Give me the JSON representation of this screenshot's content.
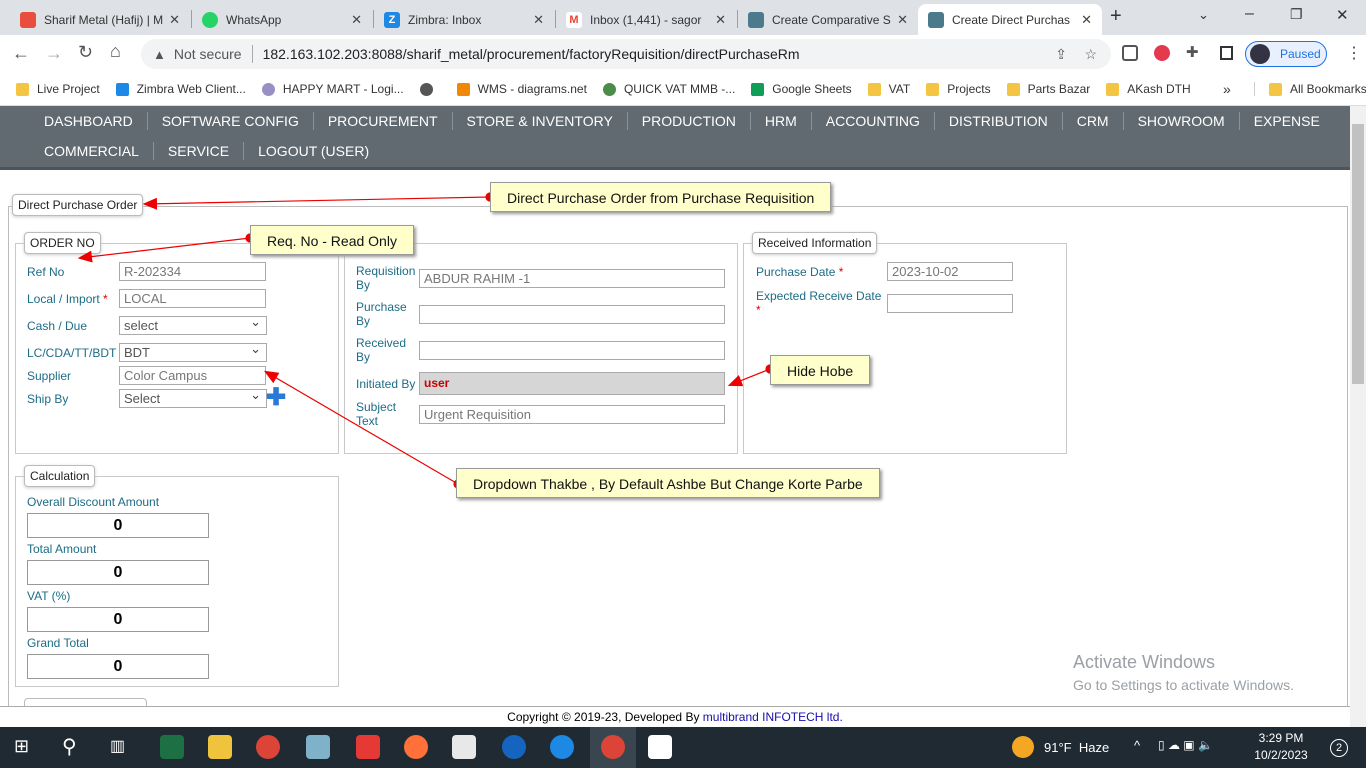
{
  "browser": {
    "tabs": [
      {
        "title": "Sharif Metal (Hafij) | M",
        "icon": "app-icon",
        "color": "#e84d3d"
      },
      {
        "title": "WhatsApp",
        "icon": "whatsapp-icon",
        "color": "#25d366"
      },
      {
        "title": "Zimbra: Inbox",
        "icon": "zimbra-icon",
        "color": "#1e88e5"
      },
      {
        "title": "Inbox (1,441) - sagor",
        "icon": "gmail-icon",
        "color": "#ea4335"
      },
      {
        "title": "Create Comparative S",
        "icon": "app-icon",
        "color": "#4a7a8c"
      },
      {
        "title": "Create Direct Purchas",
        "icon": "app-icon",
        "color": "#4a7a8c"
      }
    ],
    "security": "Not secure",
    "url": "182.163.102.203:8088/sharif_metal/procurement/factoryRequisition/directPurchaseRm",
    "profile": "Paused",
    "bookmarks": [
      {
        "label": "Live Project",
        "color": "#f4c542"
      },
      {
        "label": "Zimbra Web Client...",
        "color": "#1e88e5"
      },
      {
        "label": "HAPPY MART - Logi...",
        "color": "#9a8fc5"
      },
      {
        "label": "",
        "color": "#555"
      },
      {
        "label": "WMS - diagrams.net",
        "color": "#f08705"
      },
      {
        "label": "QUICK VAT MMB -...",
        "color": "#4c8c4a"
      },
      {
        "label": "Google Sheets",
        "color": "#0f9d58"
      },
      {
        "label": "VAT",
        "color": "#f4c542"
      },
      {
        "label": "Projects",
        "color": "#f4c542"
      },
      {
        "label": "Parts Bazar",
        "color": "#f4c542"
      },
      {
        "label": "AKash DTH",
        "color": "#f4c542"
      }
    ],
    "more": "»",
    "all_bookmarks": "All Bookmarks"
  },
  "nav": {
    "row1": [
      "DASHBOARD",
      "SOFTWARE CONFIG",
      "PROCUREMENT",
      "STORE & INVENTORY",
      "PRODUCTION",
      "HRM",
      "ACCOUNTING",
      "DISTRIBUTION",
      "CRM",
      "SHOWROOM",
      "EXPENSE"
    ],
    "row2": [
      "COMMERCIAL",
      "SERVICE",
      "LOGOUT (USER)"
    ]
  },
  "form": {
    "title": "Direct Purchase Order",
    "order": {
      "legend": "ORDER NO",
      "ref_label": "Ref No",
      "ref_value": "R-202334",
      "local_label": "Local / Import",
      "local_value": "LOCAL",
      "cash_label": "Cash / Due",
      "cash_value": "select",
      "lc_label": "LC/CDA/TT/BDT",
      "lc_value": "BDT",
      "supplier_label": "Supplier",
      "supplier_value": "Color Campus",
      "ship_label": "Ship By",
      "ship_value": "Select",
      "required": "*"
    },
    "req": {
      "req_by_label": "Requisition By",
      "req_by_value": "ABDUR RAHIM -1",
      "purchase_by_label": "Purchase By",
      "purchase_by_value": "",
      "received_by_label": "Received By",
      "received_by_value": "",
      "initiated_label": "Initiated By",
      "initiated_value": "user",
      "subject_label": "Subject Text",
      "subject_value": "Urgent Requisition"
    },
    "received": {
      "legend": "Received Information",
      "purchase_date_label": "Purchase Date",
      "purchase_date_value": "2023-10-02",
      "expected_label": "Expected Receive Date",
      "expected_value": ""
    },
    "calc": {
      "legend": "Calculation",
      "discount_label": "Overall Discount Amount",
      "discount_value": "0",
      "total_label": "Total Amount",
      "total_value": "0",
      "vat_label": "VAT (%)",
      "vat_value": "0",
      "grand_label": "Grand Total",
      "grand_value": "0"
    }
  },
  "notes": {
    "n1": "Direct Purchase Order from Purchase Requisition",
    "n2": "Req. No - Read Only",
    "n3": "Hide Hobe",
    "n4": "Dropdown Thakbe , By Default Ashbe But Change Korte Parbe"
  },
  "watermark": {
    "title": "Activate Windows",
    "sub": "Go to Settings to activate Windows."
  },
  "footer": {
    "text": "Copyright © 2019-23, Developed By ",
    "link": "multibrand INFOTECH ltd."
  },
  "taskbar": {
    "weather": "91°F  Haze",
    "time": "3:29 PM",
    "date": "10/2/2023",
    "notifications": "2"
  }
}
